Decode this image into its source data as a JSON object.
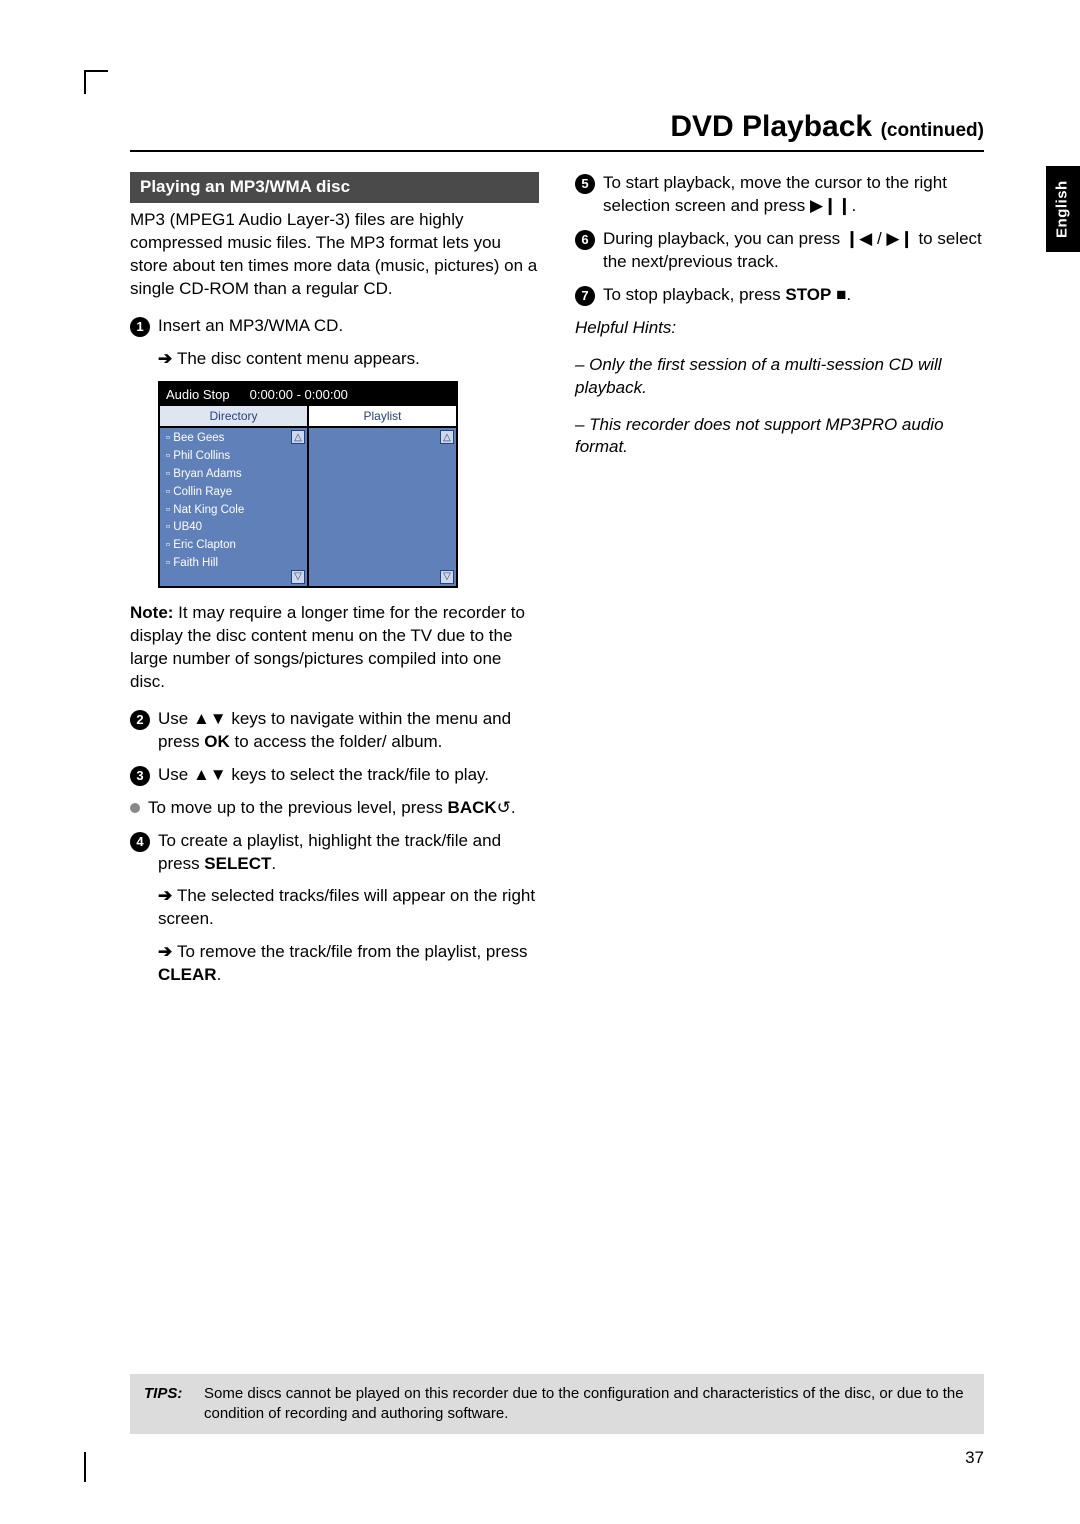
{
  "header": {
    "title": "DVD Playback",
    "subtitle": "(continued)"
  },
  "language_tab": "English",
  "section_heading": "Playing an MP3/WMA disc",
  "intro": "MP3 (MPEG1 Audio Layer-3) files are highly compressed music files.  The MP3 format lets you store about ten times more data (music, pictures) on a single CD-ROM than a regular CD.",
  "left": {
    "step1": "Insert an MP3/WMA CD.",
    "step1_result": "The disc content menu appears.",
    "osd": {
      "status": "Audio Stop",
      "time": "0:00:00 - 0:00:00",
      "col1_header": "Directory",
      "col2_header": "Playlist",
      "items": [
        "Bee Gees",
        "Phil Collins",
        "Bryan Adams",
        "Collin Raye",
        "Nat King Cole",
        "UB40",
        "Eric Clapton",
        "Faith Hill"
      ]
    },
    "note_label": "Note:",
    "note_body": " It may require a longer time for the recorder to display the disc content menu on the TV due to the large number of songs/pictures compiled into one disc.",
    "step2_a": "Use ",
    "step2_b": " keys to navigate within the menu and press ",
    "step2_ok": "OK",
    "step2_c": " to access the folder/ album.",
    "step3_a": "Use ",
    "step3_b": " keys to select the track/file to play.",
    "bullet_a": "To move up to the previous level, press ",
    "bullet_back": "BACK",
    "step4_a": "To create a playlist, highlight the track/file and press ",
    "step4_select": "SELECT",
    "step4_r1": "The selected tracks/files will appear on the right screen.",
    "step4_r2a": "To remove the track/file from the playlist, press ",
    "step4_clear": "CLEAR"
  },
  "right": {
    "step5_a": "To start playback, move the cursor to the right selection screen and press ",
    "step6_a": "During playback, you can press  ",
    "step6_b": "  to select the next/previous track.",
    "step7_a": "To stop playback, press ",
    "step7_stop": "STOP",
    "hints_label": "Helpful Hints:",
    "hint1": "–  Only the first session of a multi-session CD will playback.",
    "hint2": "–  This recorder does not support MP3PRO audio format."
  },
  "icons": {
    "updown": "▲▼",
    "back": "↺",
    "play_pause": "▶❙❙",
    "prev": "❙◀",
    "next": "▶❙",
    "stop": "■",
    "slash": " / "
  },
  "tips": {
    "label": "TIPS:",
    "text": "Some discs cannot be played on this recorder due to the configuration and characteristics of the disc, or due to the condition of recording and authoring software."
  },
  "page_number": "37"
}
